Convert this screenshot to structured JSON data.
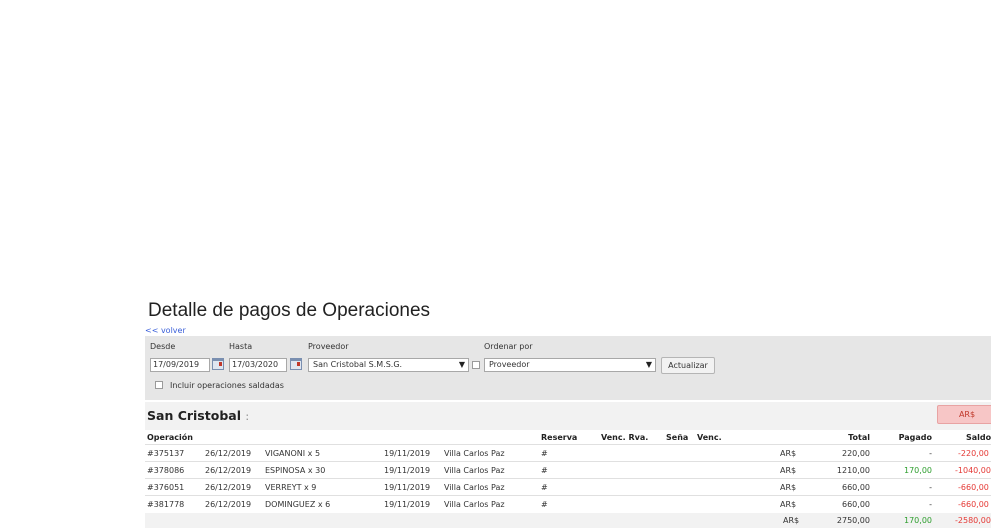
{
  "page": {
    "title": "Detalle de pagos de Operaciones",
    "back_link": "<< volver"
  },
  "filters": {
    "desde_label": "Desde",
    "desde_value": "17/09/2019",
    "hasta_label": "Hasta",
    "hasta_value": "17/03/2020",
    "proveedor_label": "Proveedor",
    "proveedor_value": "San Cristobal S.M.S.G.",
    "ordenar_label": "Ordenar por",
    "ordenar_value": "Proveedor",
    "actualizar_label": "Actualizar",
    "incluir_label": "Incluir operaciones saldadas",
    "incluir_checked": false
  },
  "group": {
    "title": "San Cristobal",
    "title_suffix": ":",
    "badge": "AR$"
  },
  "table": {
    "headers": {
      "operacion": "Operación",
      "reserva": "Reserva",
      "venc_rva": "Venc. Rva.",
      "sena": "Seña",
      "venc": "Venc.",
      "total": "Total",
      "pagado": "Pagado",
      "saldo": "Saldo"
    },
    "rows": [
      {
        "op": "#375137",
        "fecha": "26/12/2019",
        "pasajero": "VIGANONI x 5",
        "fecha_servicio": "19/11/2019",
        "destino": "Villa Carlos Paz",
        "reserva": "#",
        "moneda": "AR$",
        "total": "220,00",
        "pagado": "-",
        "saldo": "-220,00"
      },
      {
        "op": "#378086",
        "fecha": "26/12/2019",
        "pasajero": "ESPINOSA x 30",
        "fecha_servicio": "19/11/2019",
        "destino": "Villa Carlos Paz",
        "reserva": "#",
        "moneda": "AR$",
        "total": "1210,00",
        "pagado": "170,00",
        "saldo": "-1040,00"
      },
      {
        "op": "#376051",
        "fecha": "26/12/2019",
        "pasajero": "VERREYT x 9",
        "fecha_servicio": "19/11/2019",
        "destino": "Villa Carlos Paz",
        "reserva": "#",
        "moneda": "AR$",
        "total": "660,00",
        "pagado": "-",
        "saldo": "-660,00"
      },
      {
        "op": "#381778",
        "fecha": "26/12/2019",
        "pasajero": "DOMINGUEZ x 6",
        "fecha_servicio": "19/11/2019",
        "destino": "Villa Carlos Paz",
        "reserva": "#",
        "moneda": "AR$",
        "total": "660,00",
        "pagado": "-",
        "saldo": "-660,00"
      }
    ],
    "totals": {
      "moneda": "AR$",
      "total": "2750,00",
      "pagado": "170,00",
      "saldo": "-2580,00"
    }
  },
  "colors": {
    "link": "#3a5fd9",
    "panel": "#e6e6e6",
    "positive": "#2e9e2e",
    "negative": "#e53935",
    "badge_bg": "#f7c6c6"
  },
  "icons": {
    "calendar": "calendar-icon",
    "dropdown": "chevron-down-icon"
  }
}
